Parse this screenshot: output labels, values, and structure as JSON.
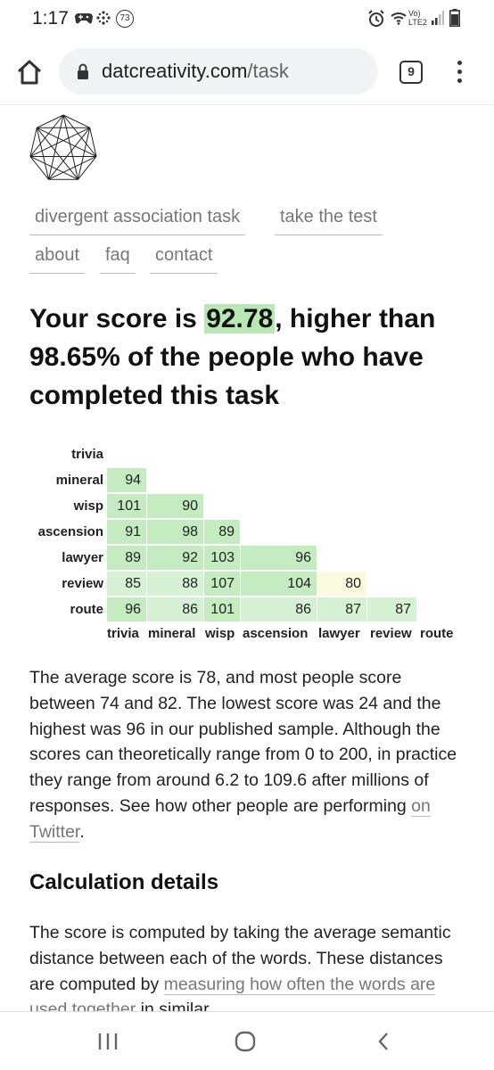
{
  "status_bar": {
    "time": "1:17",
    "notification_count": "73",
    "network": "Vo) LTE2"
  },
  "browser": {
    "url_domain": "datcreativity.com",
    "url_path": "/task",
    "tab_count": "9"
  },
  "nav": {
    "items": [
      "divergent association task",
      "take the test",
      "about",
      "faq",
      "contact"
    ]
  },
  "result": {
    "prefix": "Your score is ",
    "score": "92.78",
    "suffix": ", higher than 98.65% of the people who have completed this task"
  },
  "matrix": {
    "words": [
      "trivia",
      "mineral",
      "wisp",
      "ascension",
      "lawyer",
      "review",
      "route"
    ],
    "rows": [
      [],
      [
        "94"
      ],
      [
        "101",
        "90"
      ],
      [
        "91",
        "98",
        "89"
      ],
      [
        "89",
        "92",
        "103",
        "96"
      ],
      [
        "85",
        "88",
        "107",
        "104",
        "80"
      ],
      [
        "96",
        "86",
        "101",
        "86",
        "87",
        "87"
      ]
    ],
    "colors": {
      "high": "#c4ecc0",
      "mid": "#d6f1d3",
      "low": "#fbfcdf"
    }
  },
  "paragraph1": {
    "text": "The average score is 78, and most people score between 74 and 82. The lowest score was 24 and the highest was 96 in our published sample. Although the scores can theoretically range from 0 to 200, in practice they range from around 6.2 to 109.6 after millions of responses. See how other people are performing ",
    "link": "on Twitter",
    "end": "."
  },
  "calc": {
    "title": "Calculation details",
    "text": "The score is computed by taking the average semantic distance between each of the words. These distances are computed by ",
    "link": "measuring how often the words are used together",
    "end": " in similar"
  }
}
